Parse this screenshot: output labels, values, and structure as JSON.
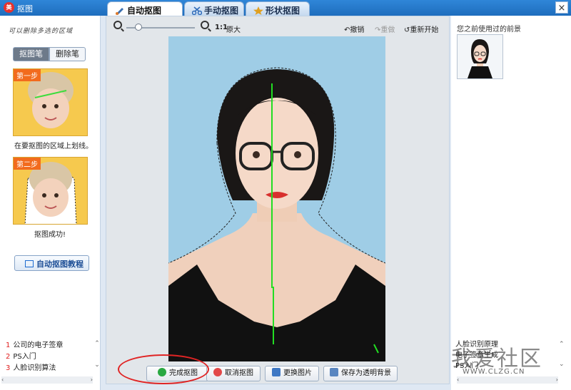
{
  "window": {
    "title": "抠图",
    "app_icon": "美",
    "close_label": "×"
  },
  "tabs": [
    {
      "label": "自动抠图",
      "icon": "brush-icon",
      "active": true
    },
    {
      "label": "手动抠图",
      "icon": "scissors-icon",
      "active": false
    },
    {
      "label": "形状抠图",
      "icon": "star-icon",
      "active": false
    }
  ],
  "left": {
    "hint": "可以删除多选的区域",
    "pen_buttons": {
      "cutout": "抠图笔",
      "eraser": "删除笔"
    },
    "steps": [
      {
        "badge": "第一步",
        "caption": "在要抠图的区域上划线。"
      },
      {
        "badge": "第二步",
        "caption": "抠图成功!"
      }
    ],
    "tutorial_label": "自动抠图教程",
    "recent_list": [
      {
        "num": "1",
        "text": "公司的电子签章"
      },
      {
        "num": "2",
        "text": "PS入门"
      },
      {
        "num": "3",
        "text": "人脸识别算法"
      }
    ]
  },
  "toolbar": {
    "zoom_ratio": "1:1",
    "original_size": "原大",
    "undo": "撤销",
    "redo": "重做",
    "restart": "重新开始"
  },
  "bottom_buttons": {
    "done": "完成抠图",
    "cancel": "取消抠图",
    "replace": "更换图片",
    "save_transparent": "保存为透明背景"
  },
  "right": {
    "title": "您之前使用过的前景",
    "list": [
      "人脸识别原理",
      "电子签章生成",
      "PS入门"
    ],
    "watermark": "我爱社区",
    "watermark_url": "WWW.CLZG.CN"
  },
  "colors": {
    "titlebar": "#1e6dbd",
    "canvas_bg": "#9fcde6",
    "stroke": "#22dd22",
    "highlight": "#e02424"
  }
}
